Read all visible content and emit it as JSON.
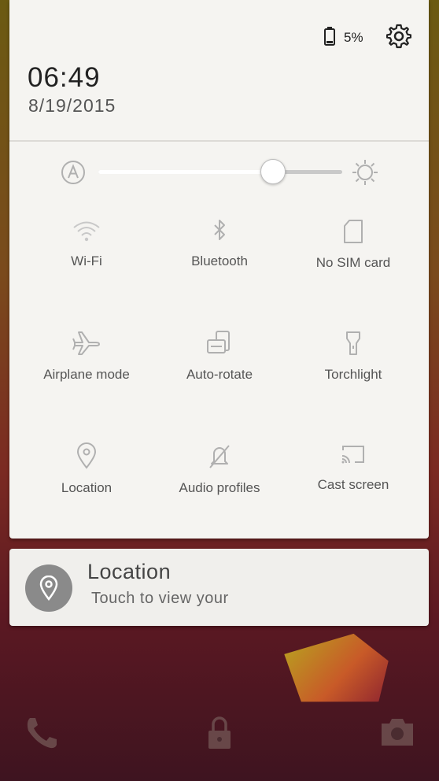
{
  "status": {
    "battery_percent": "5%",
    "time": "06:49",
    "date": "8/19/2015"
  },
  "brightness": {
    "level": 0.72,
    "auto_icon": "auto-brightness-icon",
    "max_icon": "sun-icon"
  },
  "tiles": [
    {
      "label": "Wi-Fi",
      "icon": "wifi-icon"
    },
    {
      "label": "Bluetooth",
      "icon": "bluetooth-icon"
    },
    {
      "label": "No SIM card",
      "icon": "sim-card-icon"
    },
    {
      "label": "Airplane mode",
      "icon": "airplane-icon"
    },
    {
      "label": "Auto-rotate",
      "icon": "rotate-icon"
    },
    {
      "label": "Torchlight",
      "icon": "flashlight-icon"
    },
    {
      "label": "Location",
      "icon": "location-pin-icon"
    },
    {
      "label": "Audio profiles",
      "icon": "muted-bell-icon"
    },
    {
      "label": "Cast screen",
      "icon": "cast-icon"
    }
  ],
  "notification": {
    "title": "Location",
    "text": "Touch to view your"
  },
  "colors": {
    "panel": "#f5f4f1",
    "icon_gray": "#b0b0b0",
    "text_dark": "#222222"
  }
}
